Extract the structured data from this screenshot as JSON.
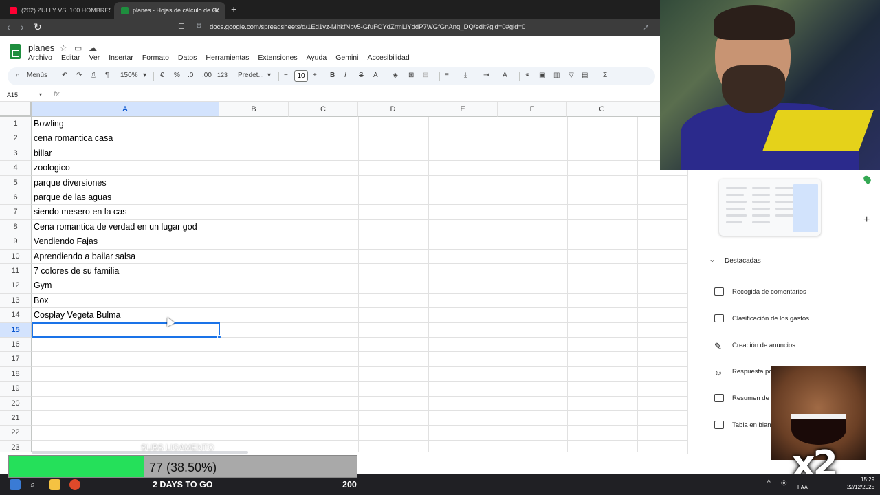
{
  "browser": {
    "tabs": [
      {
        "title": "(202) ZULLY VS. 100 HOMBRES - You",
        "active": false,
        "favicon_color": "#ff0033"
      },
      {
        "title": "planes - Hojas de cálculo de Goo",
        "active": true,
        "favicon_color": "#1e8e3e"
      }
    ],
    "new_tab": "+",
    "url": "docs.google.com/spreadsheets/d/1Ed1yz-MhkfNbv5-GfuFOYdZrmLiYddP7WGfGnAnq_DQ/edit?gid=0#gid=0"
  },
  "sheet": {
    "title": "planes",
    "menus": [
      "Archivo",
      "Editar",
      "Ver",
      "Insertar",
      "Formato",
      "Datos",
      "Herramientas",
      "Extensiones",
      "Ayuda",
      "Gemini",
      "Accesibilidad"
    ],
    "toolbar": {
      "search": "Menús",
      "zoom": "150%",
      "currency": "€",
      "percent": "%",
      "dec_less": ".0",
      "dec_more": ".00",
      "number_format": "123",
      "font": "Predet...",
      "font_size": "10"
    },
    "name_box": "A15",
    "fx": "fx",
    "columns": [
      "A",
      "B",
      "C",
      "D",
      "E",
      "F",
      "G"
    ],
    "selected_column": "A",
    "selected_row": 15,
    "rows": [
      {
        "n": "1",
        "a": "Bowling"
      },
      {
        "n": "2",
        "a": "cena romantica casa"
      },
      {
        "n": "3",
        "a": "billar"
      },
      {
        "n": "4",
        "a": "zoologico"
      },
      {
        "n": "5",
        "a": "parque diversiones"
      },
      {
        "n": "6",
        "a": "parque de las aguas"
      },
      {
        "n": "7",
        "a": "siendo mesero en la cas"
      },
      {
        "n": "8",
        "a": "Cena romantica de verdad en un lugar god"
      },
      {
        "n": "9",
        "a": "Vendiendo Fajas"
      },
      {
        "n": "10",
        "a": "Aprendiendo a bailar salsa"
      },
      {
        "n": "11",
        "a": "7 colores de su familia"
      },
      {
        "n": "12",
        "a": "Gym"
      },
      {
        "n": "13",
        "a": "Box"
      },
      {
        "n": "14",
        "a": "Cosplay Vegeta Bulma"
      },
      {
        "n": "15",
        "a": ""
      },
      {
        "n": "16",
        "a": ""
      },
      {
        "n": "17",
        "a": ""
      },
      {
        "n": "18",
        "a": ""
      },
      {
        "n": "19",
        "a": ""
      },
      {
        "n": "20",
        "a": ""
      },
      {
        "n": "21",
        "a": ""
      },
      {
        "n": "22",
        "a": ""
      },
      {
        "n": "23",
        "a": ""
      }
    ]
  },
  "side_panel": {
    "section": "Destacadas",
    "items": [
      "Recogida de comentarios",
      "Clasificación de los gastos",
      "Creación de anuncios",
      "Respuesta po",
      "Resumen de l",
      "Tabla en blan"
    ]
  },
  "stream": {
    "subs_ghost": "SUBS LIGAMENTO",
    "progress_label": "77 (38.50%)",
    "progress_fraction": 0.385,
    "days": "2 DAYS TO GO",
    "goal": "200",
    "multiplier": "x2"
  },
  "taskbar": {
    "lang": "LAA",
    "time": "15:29",
    "date": "22/12/2025"
  },
  "colors": {
    "accent": "#1a73e8",
    "progress_green": "#25e05a",
    "sheets_green": "#1e8e3e"
  }
}
